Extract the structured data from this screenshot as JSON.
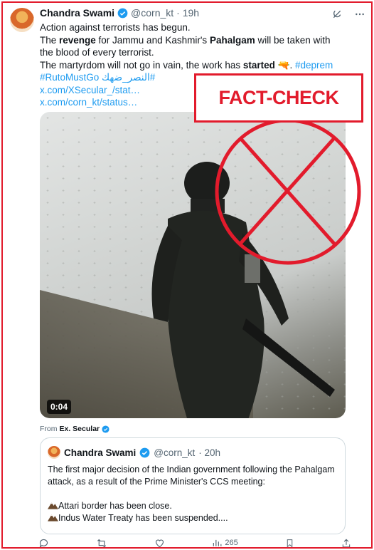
{
  "tweet": {
    "author_name": "Chandra Swami",
    "author_handle": "@corn_kt",
    "time": "· 19h",
    "text_line1": "Action against terrorists has begun.",
    "text_line2a": "The ",
    "text_line2b": "revenge",
    "text_line2c": " for Jammu and Kashmir's ",
    "text_line2d": "Pahalgam",
    "text_line2e": " will be taken with the blood of every terrorist.",
    "text_line3a": "The martyrdom will not go in vain, the work has ",
    "text_line3b": "started",
    "text_line3c": " 🔫. ",
    "hashtag1": "#deprem",
    "hashtag2": "#RutoMustGo النصر_ضهك#",
    "link1": "x.com/XSecular_/stat…",
    "link2": "x.com/corn_kt/status…"
  },
  "media": {
    "duration": "0:04",
    "from_label": "From",
    "from_source": "Ex. Secular"
  },
  "overlay": {
    "fact_check_label": "FACT-CHECK"
  },
  "quote": {
    "author_name": "Chandra Swami",
    "author_handle": "@corn_kt",
    "time": "· 20h",
    "text1": "The first major decision of the Indian government following the Pahalgam attack, as a result of the Prime Minister's CCS meeting:",
    "item1": "Attari border has been close.",
    "item2": "Indus Water Treaty has been suspended...."
  },
  "actions": {
    "views_count": "265"
  },
  "colors": {
    "accent": "#1d9bf0",
    "fact_check_red": "#e21b2c"
  }
}
